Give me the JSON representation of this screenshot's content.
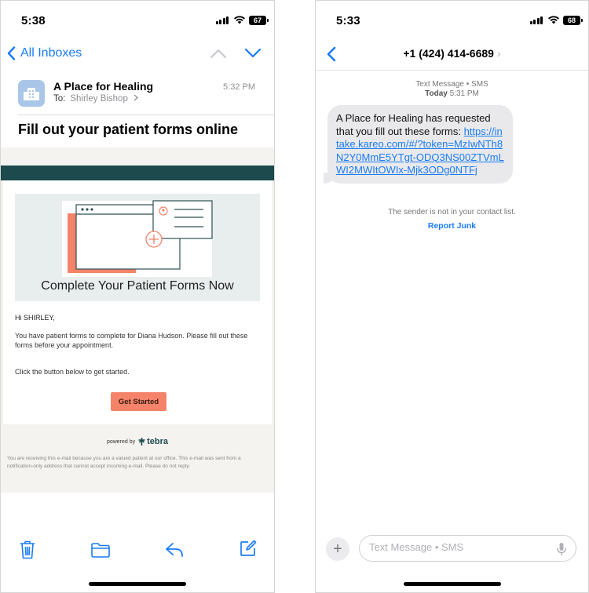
{
  "mail_screen": {
    "status": {
      "time": "5:38",
      "battery": "67"
    },
    "nav": {
      "back_label": "All Inboxes"
    },
    "sender": {
      "name": "A Place for Healing",
      "to_label": "To:",
      "recipient": "Shirley Bishop",
      "time": "5:32 PM"
    },
    "subject": "Fill out your patient forms online",
    "email": {
      "hero_title": "Complete Your Patient Forms Now",
      "greeting": "Hi SHIRLEY,",
      "body1": "You have patient forms to complete for Diana Hudson. Please fill out these forms before your appointment.",
      "body2": "Click the button below to get started.",
      "cta_label": "Get Started",
      "powered_by": "powered by",
      "brand": "tebra",
      "footer": "You are receiving this e-mail because you are a valued patient at our office. This e-mail was sent from a notification-only address that cannot accept incoming e-mail. Please do not reply."
    },
    "toolbar_icons": [
      "trash-icon",
      "folder-icon",
      "reply-icon",
      "compose-icon"
    ],
    "accent_color": "#1a7cf5",
    "brand_color": "#1d4a4c",
    "cta_color": "#f4836a"
  },
  "messages_screen": {
    "status": {
      "time": "5:33",
      "battery": "68"
    },
    "contact": "+1 (424) 414-6689",
    "meta": {
      "type": "Text Message • SMS",
      "day": "Today",
      "time": "5:31 PM"
    },
    "message": {
      "text": "A Place for Healing has requested that you fill out these forms: ",
      "link": "https://intake.kareo.com/#/?token=MzIwNTh8N2Y0MmE5YTgt-ODQ3NS00ZTVmLWI2MWItOWIx-Mjk3ODg0NTFj"
    },
    "notice": "The sender is not in your contact list.",
    "report_label": "Report Junk",
    "input_placeholder": "Text Message • SMS",
    "bubble_color": "#e9e9eb"
  }
}
